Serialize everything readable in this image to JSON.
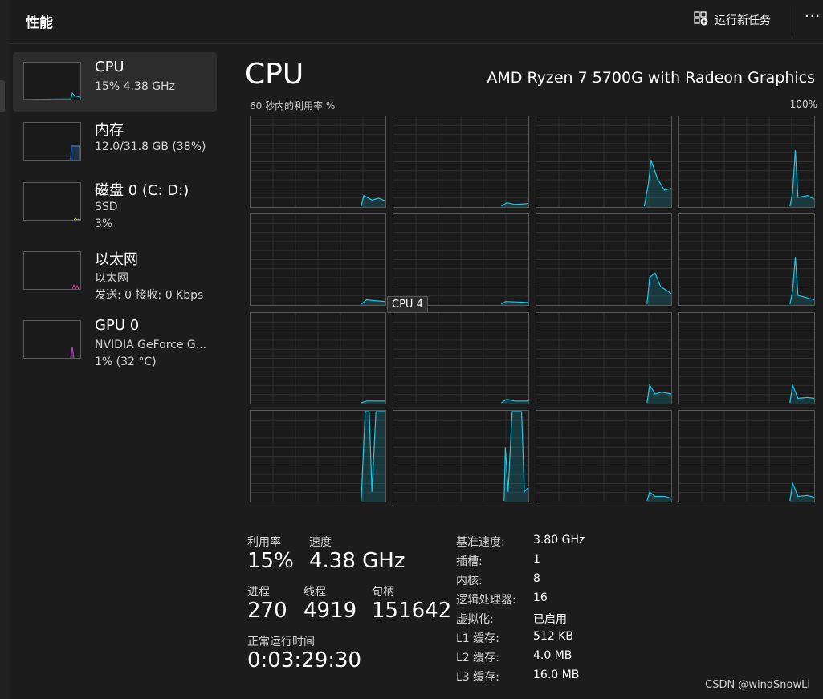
{
  "header": {
    "title": "性能",
    "run_task_label": "运行新任务",
    "more_label": "···"
  },
  "sidebar": {
    "items": [
      {
        "name": "CPU",
        "sub1": "15% 4.38 GHz",
        "sub2": "",
        "selected": true,
        "color": "#1ec8e6",
        "level": 0.15
      },
      {
        "name": "内存",
        "sub1": "12.0/31.8 GB (38%)",
        "sub2": "",
        "selected": false,
        "color": "#3a7bd5",
        "level": 0.38
      },
      {
        "name": "磁盘 0 (C: D:)",
        "sub1": "SSD",
        "sub2": "3%",
        "selected": false,
        "color": "#9acd32",
        "level": 0.03
      },
      {
        "name": "以太网",
        "sub1": "以太网",
        "sub2": "发送: 0 接收: 0 Kbps",
        "selected": false,
        "color": "#d6409f",
        "level": 0.0
      },
      {
        "name": "GPU 0",
        "sub1": "NVIDIA GeForce G...",
        "sub2": "1% (32 °C)",
        "selected": false,
        "color": "#c040d0",
        "level": 0.01
      }
    ]
  },
  "main": {
    "title": "CPU",
    "model": "AMD Ryzen 7 5700G with Radeon Graphics",
    "graph_caption": "60 秒内的利用率 %",
    "graph_max": "100%",
    "tooltip": "CPU 4",
    "graph_color": "#1ec8e6"
  },
  "stats": {
    "utilization_label": "利用率",
    "utilization": "15%",
    "speed_label": "速度",
    "speed": "4.38 GHz",
    "processes_label": "进程",
    "processes": "270",
    "threads_label": "线程",
    "threads": "4919",
    "handles_label": "句柄",
    "handles": "151642",
    "uptime_label": "正常运行时间",
    "uptime": "0:03:29:30"
  },
  "specs": [
    {
      "label": "基准速度:",
      "value": "3.80 GHz"
    },
    {
      "label": "插槽:",
      "value": "1"
    },
    {
      "label": "内核:",
      "value": "8"
    },
    {
      "label": "逻辑处理器:",
      "value": "16"
    },
    {
      "label": "虚拟化:",
      "value": "已启用"
    },
    {
      "label": "L1 缓存:",
      "value": "512 KB"
    },
    {
      "label": "L2 缓存:",
      "value": "4.0 MB"
    },
    {
      "label": "L3 缓存:",
      "value": "16.0 MB"
    }
  ],
  "watermark": "CSDN @windSnowLi"
}
